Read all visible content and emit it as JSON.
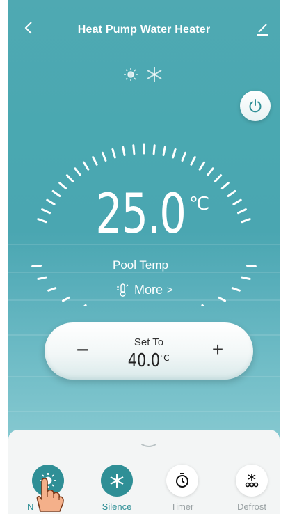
{
  "header": {
    "title": "Heat Pump Water Heater"
  },
  "status_icons": [
    "sun-icon",
    "snowflake-icon"
  ],
  "current": {
    "temperature": "25.0",
    "unit": "℃",
    "label": "Pool Temp"
  },
  "more": {
    "label": "More",
    "chevron": ">"
  },
  "setpoint": {
    "label": "Set To",
    "value": "40.0",
    "unit": "℃",
    "minus": "−",
    "plus": "+"
  },
  "modes": [
    {
      "label": "",
      "icon": "sun-icon",
      "active": true
    },
    {
      "label": "Silence",
      "icon": "fan-icon",
      "active": true
    },
    {
      "label": "Timer",
      "icon": "timer-icon",
      "active": false
    },
    {
      "label": "Defrost",
      "icon": "defrost-icon",
      "active": false
    }
  ],
  "partial_label_first_mode": "N",
  "colors": {
    "accent": "#2f8f96",
    "sky": "#4aa8b1",
    "inactive_text": "#9aa2a4"
  }
}
